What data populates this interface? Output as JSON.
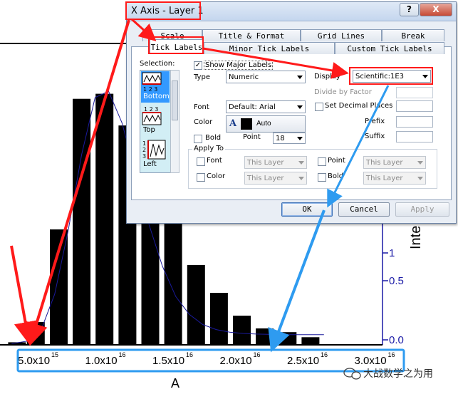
{
  "chart_data": {
    "type": "bar",
    "x_tick_labels": [
      {
        "mantissa": "5.0x10",
        "exp": "15"
      },
      {
        "mantissa": "1.0x10",
        "exp": "16"
      },
      {
        "mantissa": "1.5x10",
        "exp": "16"
      },
      {
        "mantissa": "2.0x10",
        "exp": "16"
      },
      {
        "mantissa": "2.5x10",
        "exp": "16"
      },
      {
        "mantissa": "3.0x10",
        "exp": "16"
      }
    ],
    "xlabel": "A",
    "ylabel_right": "Inte",
    "y_tick_labels_right": [
      "0.0",
      "0.5",
      "1"
    ],
    "bars": {
      "x": [
        4200000000000000.0,
        5600000000000000.0,
        7300000000000000.0,
        9000000000000000.0,
        1.07e+16,
        1.24e+16,
        1.41e+16,
        1.58e+16,
        1.75e+16,
        1.92e+16,
        2.09e+16,
        2.26e+16,
        2.43e+16,
        2.6e+16
      ],
      "values": [
        0.02,
        0.18,
        0.91,
        1.94,
        1.98,
        1.73,
        1.28,
        0.98,
        0.63,
        0.41,
        0.23,
        0.13,
        0.1,
        0.06
      ]
    },
    "fit_curve": {
      "x": [
        3800000000000000.0,
        5000000000000000.0,
        6000000000000000.0,
        7000000000000000.0,
        8000000000000000.0,
        9000000000000000.0,
        1e+16,
        1.1e+16,
        1.2e+16,
        1.3e+16,
        1.4e+16,
        1.5e+16,
        1.6e+16,
        1.7e+16,
        1.8e+16,
        1.9e+16,
        2e+16,
        2.1e+16,
        2.2e+16,
        2.4e+16,
        2.7e+16
      ],
      "values": [
        0.01,
        0.03,
        0.12,
        0.4,
        0.9,
        1.5,
        1.95,
        2.0,
        1.75,
        1.35,
        0.95,
        0.62,
        0.38,
        0.24,
        0.16,
        0.12,
        0.1,
        0.09,
        0.085,
        0.08,
        0.08
      ]
    },
    "xlim": [
      3000000000000000.0,
      3.3e+16
    ],
    "ylim": [
      0,
      2.4
    ]
  },
  "watermark": "大战数学之为用",
  "dialog": {
    "title": "X Axis - Layer 1",
    "help_label": "?",
    "close_label": "X",
    "tabs_back": [
      "Scale",
      "Title & Format",
      "Grid Lines",
      "Break"
    ],
    "tabs_front": [
      "Tick Labels",
      "Minor Tick Labels",
      "Custom Tick Labels"
    ],
    "selection_label": "Selection:",
    "selection_items": [
      {
        "label": "Bottom",
        "selected": true
      },
      {
        "label": "Top",
        "selected": false
      },
      {
        "label": "Left",
        "selected": false
      }
    ],
    "show_major_labels": "Show Major Labels",
    "type_label": "Type",
    "type_value": "Numeric",
    "display_label": "Display",
    "display_value": "Scientific:1E3",
    "divide_by_factor": "Divide by Factor",
    "set_decimal_places": "Set Decimal Places",
    "prefix_label": "Prefix",
    "suffix_label": "Suffix",
    "font_label": "Font",
    "font_value": "Default: Arial",
    "color_label": "Color",
    "color_value": "Auto",
    "bold_label": "Bold",
    "point_label": "Point",
    "point_value": "18",
    "apply_to_label": "Apply To",
    "apply_font": "Font",
    "apply_color": "Color",
    "apply_point": "Point",
    "apply_bold": "Bold",
    "this_layer": "This Layer",
    "ok": "OK",
    "cancel": "Cancel",
    "apply": "Apply"
  },
  "colors": {
    "highlight_red": "#ff1a1a",
    "highlight_blue": "#2e9bf0",
    "fit_line": "#1a1a9c"
  }
}
